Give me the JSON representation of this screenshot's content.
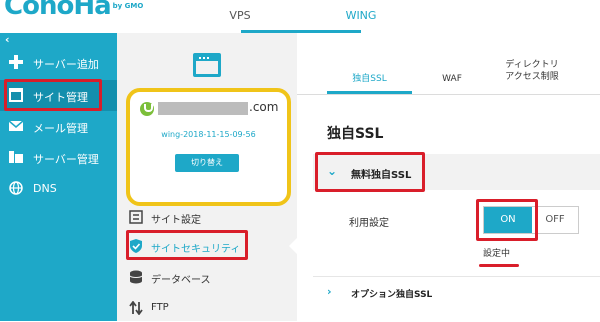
{
  "brand": {
    "logo_text": "ConoHa",
    "logo_sub": "by GMO"
  },
  "top_tabs": [
    {
      "label": "VPS"
    },
    {
      "label": "WING"
    }
  ],
  "sidebar": {
    "collapse_glyph": "‹",
    "items": [
      {
        "label": "サーバー追加",
        "icon": "plus-icon"
      },
      {
        "label": "サイト管理",
        "icon": "window-icon"
      },
      {
        "label": "メール管理",
        "icon": "mail-icon"
      },
      {
        "label": "サーバー管理",
        "icon": "server-icon"
      },
      {
        "label": "DNS",
        "icon": "globe-icon"
      }
    ]
  },
  "site_card": {
    "domain_suffix": ".com",
    "wing_name": "wing-2018-11-15-09-56",
    "switch_label": "切り替え"
  },
  "mid_menu": [
    {
      "label": "サイト設定",
      "icon": "settings-icon"
    },
    {
      "label": "サイトセキュリティ",
      "icon": "shield-icon"
    },
    {
      "label": "データベース",
      "icon": "database-icon"
    },
    {
      "label": "FTP",
      "icon": "transfer-icon"
    }
  ],
  "right_tabs": [
    {
      "label": "独自SSL"
    },
    {
      "label": "WAF"
    },
    {
      "label": "ディレクトリ\nアクセス制限"
    }
  ],
  "section_title": "独自SSL",
  "free_ssl": {
    "label": "無料独自SSL",
    "setting_label": "利用設定",
    "on_label": "ON",
    "off_label": "OFF",
    "status": "設定中"
  },
  "option_ssl_label": "オプション独自SSL",
  "colors": {
    "accent": "#1ea8c8",
    "highlight_red": "#d91e2a",
    "highlight_yellow": "#f0c419"
  }
}
